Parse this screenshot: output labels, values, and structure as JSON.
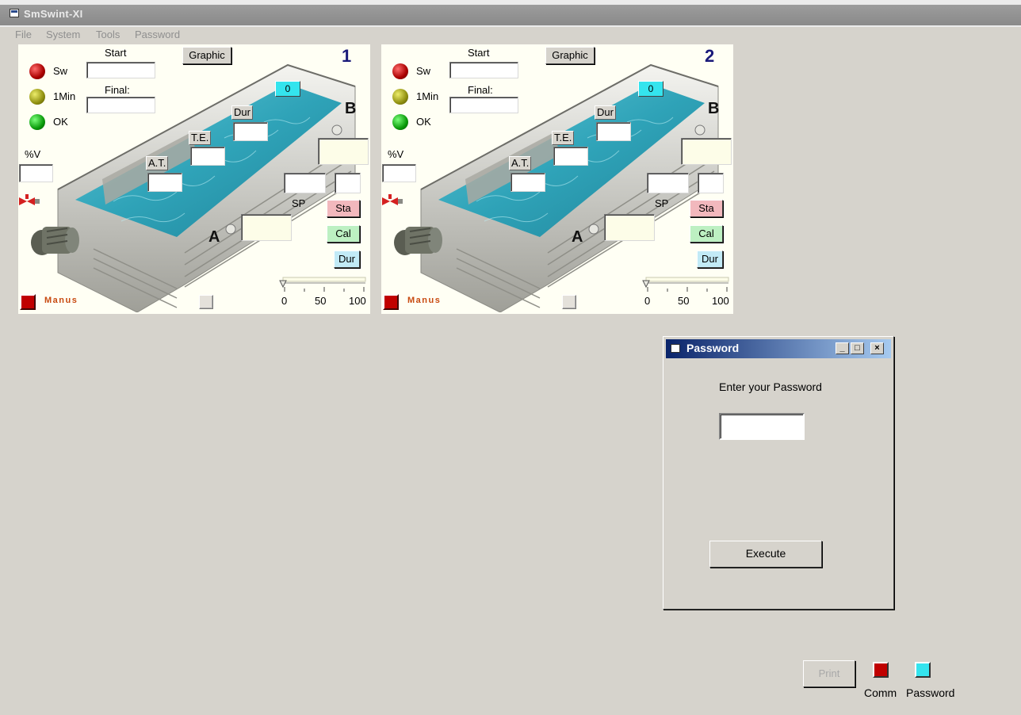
{
  "app": {
    "title": "SmSwint-XI"
  },
  "menu": [
    "File",
    "System",
    "Tools",
    "Password"
  ],
  "panels": [
    {
      "number": "1",
      "graphic_label": "Graphic",
      "start_label": "Start",
      "final_label": "Final:",
      "sw_label": "Sw",
      "min_label": "1Min",
      "ok_label": "OK",
      "pv_label": "%V",
      "counter": "0",
      "dur_tag": "Dur",
      "te_tag": "T.E.",
      "at_tag": "A.T.",
      "sp_label": "SP",
      "letter_a": "A",
      "letter_b": "B",
      "sta_label": "Sta",
      "cal_label": "Cal",
      "dur_label": "Dur",
      "manus_label": "Manus",
      "slider_ticks": [
        "0",
        "50",
        "100"
      ]
    },
    {
      "number": "2",
      "graphic_label": "Graphic",
      "start_label": "Start",
      "final_label": "Final:",
      "sw_label": "Sw",
      "min_label": "1Min",
      "ok_label": "OK",
      "pv_label": "%V",
      "counter": "0",
      "dur_tag": "Dur",
      "te_tag": "T.E.",
      "at_tag": "A.T.",
      "sp_label": "SP",
      "letter_a": "A",
      "letter_b": "B",
      "sta_label": "Sta",
      "cal_label": "Cal",
      "dur_label": "Dur",
      "manus_label": "Manus",
      "slider_ticks": [
        "0",
        "50",
        "100"
      ]
    }
  ],
  "dialog": {
    "title": "Password",
    "prompt": "Enter your Password",
    "password_value": "",
    "execute_label": "Execute",
    "minimize": "_",
    "maximize": "□",
    "close": "×"
  },
  "footer": {
    "print_label": "Print",
    "comm_label": "Comm",
    "password_label": "Password"
  },
  "colors": {
    "water": "#2fa3b8",
    "counter_badge": "#34e4ee",
    "comm_led": "#c00000",
    "password_led": "#34e4ee",
    "dialog_title": "#0a246a"
  },
  "icons": [
    "app-window-icon",
    "red-led-icon",
    "yellow-led-icon",
    "green-led-icon",
    "valve-icon",
    "motor-icon",
    "slider-icon"
  ]
}
